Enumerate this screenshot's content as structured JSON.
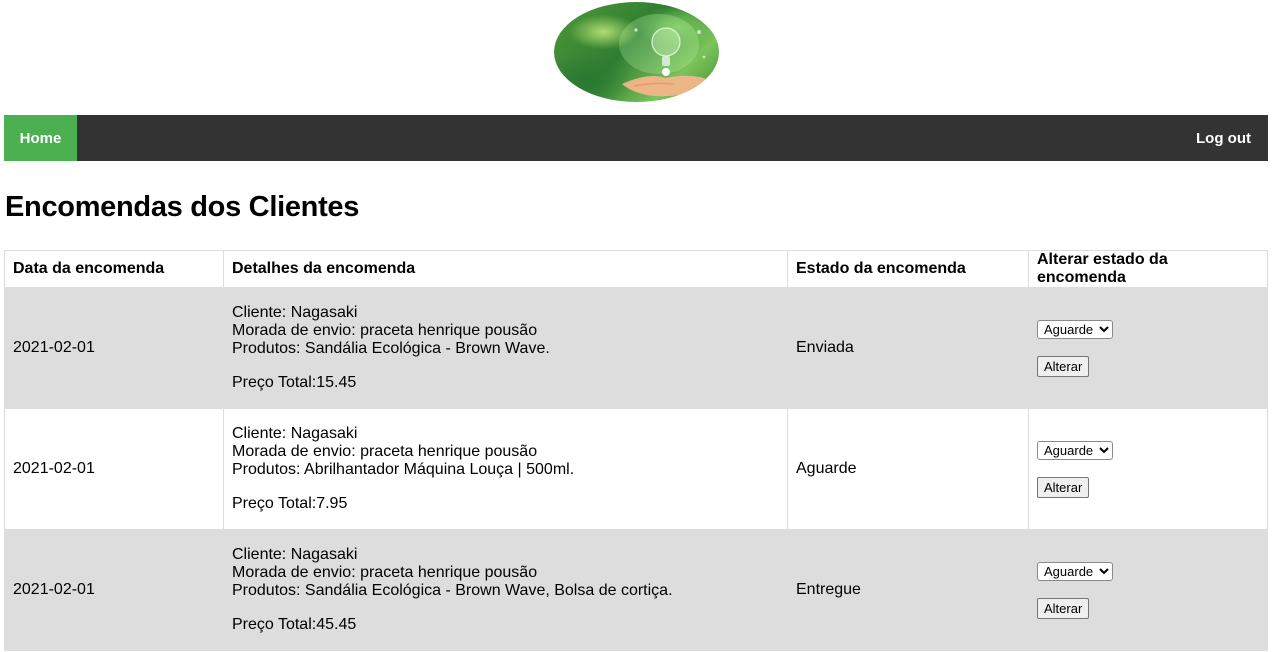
{
  "nav": {
    "home_label": "Home",
    "logout_label": "Log out"
  },
  "page": {
    "title": "Encomendas dos Clientes"
  },
  "table": {
    "headers": [
      "Data da encomenda",
      "Detalhes da encomenda",
      "Estado da encomenda",
      "Alterar estado da encomenda"
    ],
    "rows": [
      {
        "date": "2021-02-01",
        "client": "Cliente: Nagasaki",
        "address": "Morada de envio: praceta henrique pousão",
        "products": "Produtos: Sandália Ecológica - Brown Wave.",
        "total": "Preço Total:15.45",
        "status": "Enviada",
        "select_value": "Aguarde",
        "button_label": "Alterar"
      },
      {
        "date": "2021-02-01",
        "client": "Cliente: Nagasaki",
        "address": "Morada de envio: praceta henrique pousão",
        "products": "Produtos: Abrilhantador Máquina Louça | 500ml.",
        "total": "Preço Total:7.95",
        "status": "Aguarde",
        "select_value": "Aguarde",
        "button_label": "Alterar"
      },
      {
        "date": "2021-02-01",
        "client": "Cliente: Nagasaki",
        "address": "Morada de envio: praceta henrique pousão",
        "products": "Produtos: Sandália Ecológica - Brown Wave, Bolsa de cortiça.",
        "total": "Preço Total:45.45",
        "status": "Entregue",
        "select_value": "Aguarde",
        "button_label": "Alterar"
      }
    ]
  },
  "icons": {
    "logo": "lightbulb-in-hand-logo"
  }
}
